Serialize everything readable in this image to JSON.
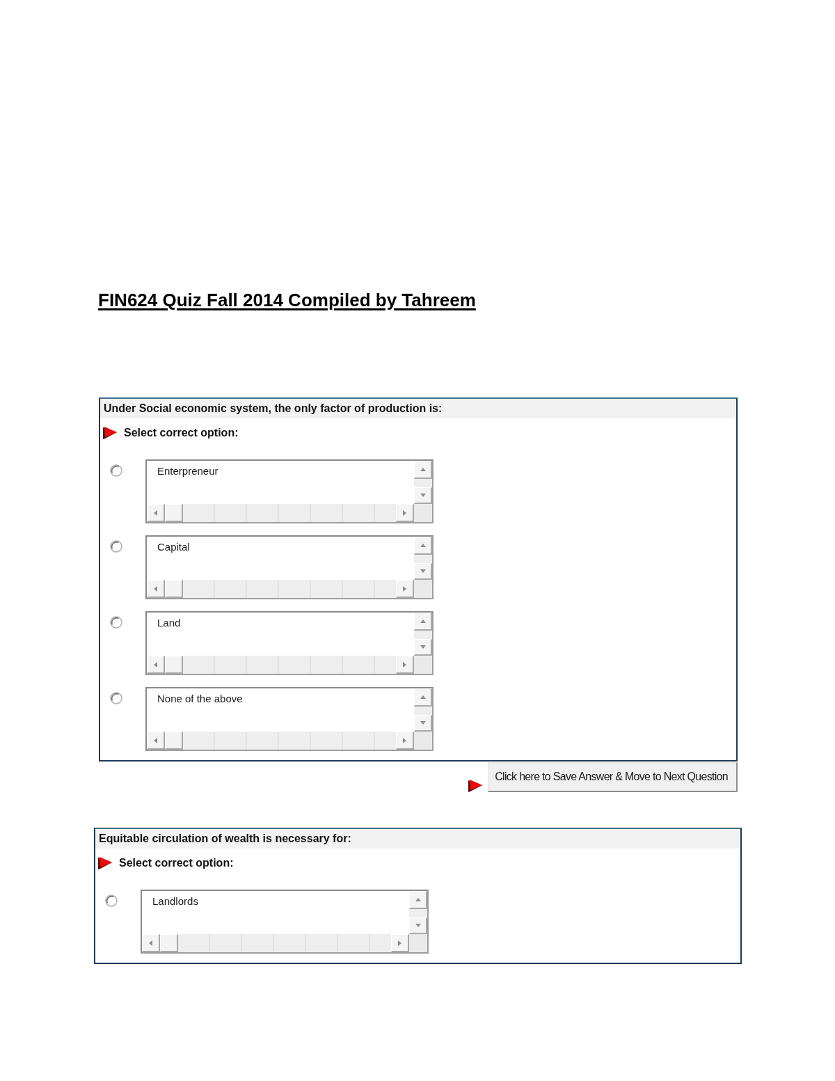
{
  "title": "FIN624 Quiz Fall 2014 Compiled by Tahreem",
  "questions": [
    {
      "prompt": "Under Social economic system, the only factor of production is:",
      "instruction": "Select correct option:",
      "options": [
        {
          "text": "Enterpreneur",
          "selected": false
        },
        {
          "text": "Capital",
          "selected": false
        },
        {
          "text": "Land",
          "selected": false
        },
        {
          "text": "None of the above",
          "selected": false
        }
      ],
      "submit_button": {
        "label": "Click here to Save Answer & Move to Next Question"
      }
    },
    {
      "prompt": "Equitable circulation of wealth is necessary for:",
      "instruction": "Select correct option:",
      "options": [
        {
          "text": "Landlords",
          "selected": false
        }
      ]
    }
  ]
}
